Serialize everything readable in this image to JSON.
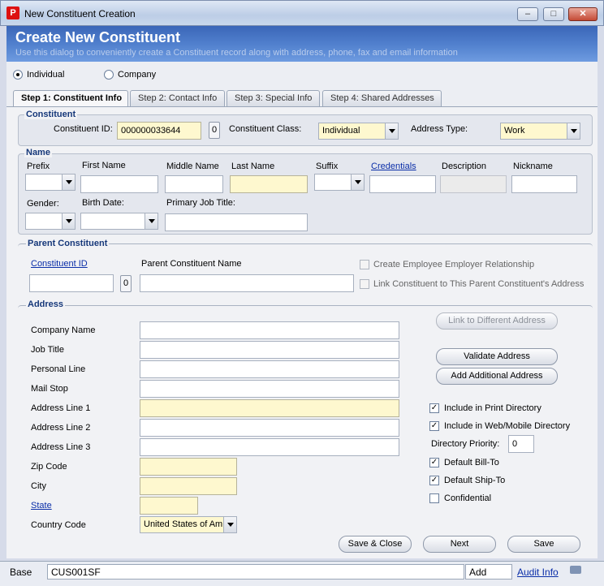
{
  "window": {
    "title": "New Constituent Creation",
    "app_icon": "P"
  },
  "header": {
    "title": "Create New Constituent",
    "subtitle": "Use this dialog to conveniently create a Constituent record along with address, phone, fax and email information"
  },
  "type_options": {
    "individual": "Individual",
    "company": "Company",
    "selected": "individual"
  },
  "tabs": [
    {
      "label": "Step 1: Constituent Info",
      "active": true
    },
    {
      "label": "Step 2: Contact Info"
    },
    {
      "label": "Step 3: Special Info"
    },
    {
      "label": "Step 4: Shared Addresses"
    }
  ],
  "constituent": {
    "legend": "Constituent",
    "id_label": "Constituent ID:",
    "id_value": "000000033644",
    "id_btn": "0",
    "class_label": "Constituent Class:",
    "class_value": "Individual",
    "address_type_label": "Address Type:",
    "address_type_value": "Work"
  },
  "name": {
    "legend": "Name",
    "prefix": "Prefix",
    "first_name": "First Name",
    "middle_name": "Middle Name",
    "last_name": "Last Name",
    "suffix": "Suffix",
    "credentials": "Credentials",
    "description": "Description",
    "nickname": "Nickname",
    "gender": "Gender:",
    "birth_date": "Birth Date:",
    "primary_job_title": "Primary Job Title:"
  },
  "parent": {
    "legend": "Parent Constituent",
    "id_label": "Constituent ID",
    "id_btn": "0",
    "name_label": "Parent Constituent Name",
    "create_relationship": "Create Employee Employer Relationship",
    "link_address": "Link Constituent to This Parent Constituent's Address"
  },
  "address": {
    "legend": "Address",
    "company_name": "Company Name",
    "job_title": "Job Title",
    "personal_line": "Personal Line",
    "mail_stop": "Mail Stop",
    "line1": "Address Line 1",
    "line2": "Address Line 2",
    "line3": "Address Line 3",
    "zip": "Zip Code",
    "city": "City",
    "state": "State",
    "country_code": "Country Code",
    "country_value": "United States of Am",
    "link_different": "Link to Different Address",
    "validate": "Validate Address",
    "add_additional": "Add Additional Address",
    "print_directory": "Include in Print Directory",
    "web_directory": "Include in Web/Mobile Directory",
    "directory_priority": "Directory Priority:",
    "directory_priority_value": "0",
    "bill_to": "Default Bill-To",
    "ship_to": "Default Ship-To",
    "confidential": "Confidential",
    "checked": {
      "print_directory": true,
      "web_directory": true,
      "bill_to": true,
      "ship_to": true,
      "confidential": false
    }
  },
  "actions": {
    "save_close": "Save & Close",
    "next": "Next",
    "save": "Save"
  },
  "status_bar": {
    "mode": "Base",
    "code": "CUS001SF",
    "action": "Add",
    "audit": "Audit Info"
  }
}
